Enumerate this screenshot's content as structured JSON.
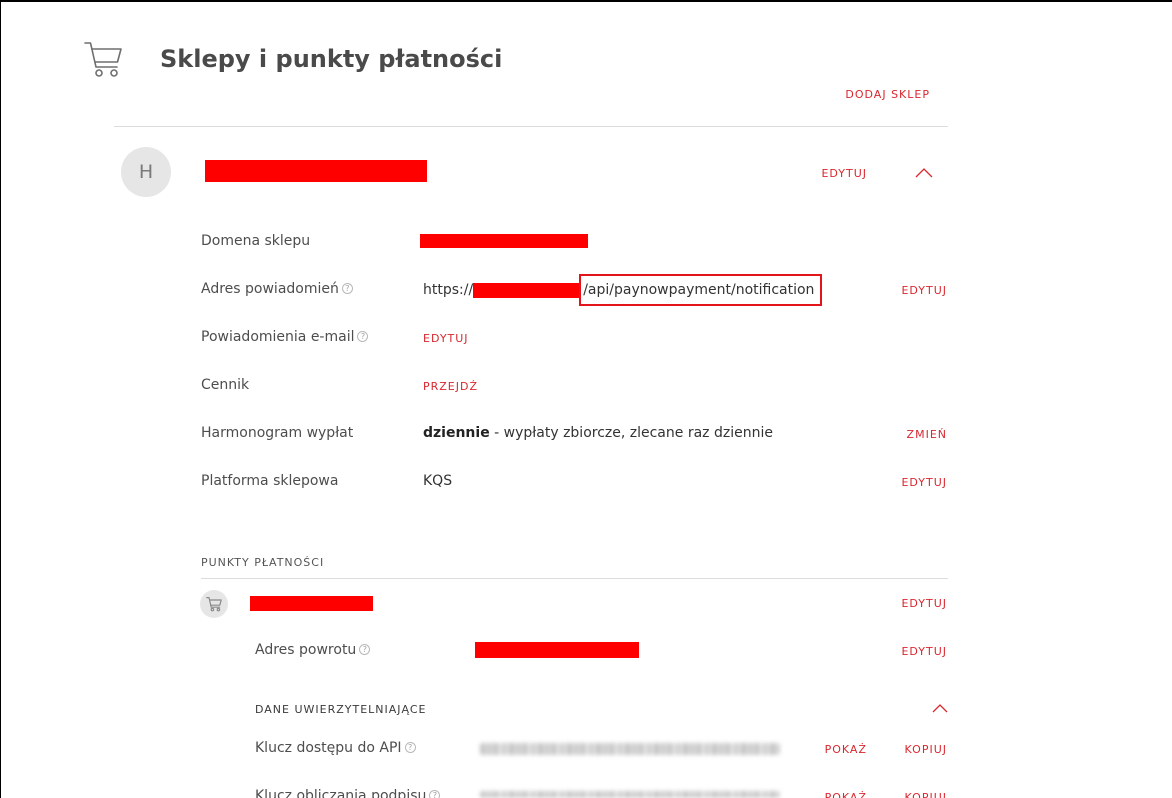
{
  "page": {
    "title": "Sklepy i punkty płatności",
    "add_shop_label": "DODAJ SKLEP"
  },
  "icons": {
    "header": "shopping-cart-icon",
    "help": "help-icon",
    "collapse": "chevron-up-icon",
    "payment_point": "shopping-cart-icon"
  },
  "colors": {
    "accent": "#d9272e",
    "highlight_box": "#e3141b",
    "redaction": "#ff0000",
    "avatar_bg": "#e6e6e6",
    "title": "#4a4a4a"
  },
  "shop": {
    "avatar_letter": "H",
    "edit_label": "EDYTUJ",
    "details": {
      "domain": {
        "label": "Domena sklepu"
      },
      "notification_url": {
        "label": "Adres powiadomień",
        "prefix": "https://",
        "path": "/api/paynowpayment/notification",
        "action": "EDYTUJ"
      },
      "email_notifications": {
        "label": "Powiadomienia e-mail",
        "action": "EDYTUJ"
      },
      "pricing": {
        "label": "Cennik",
        "action": "PRZEJDŹ"
      },
      "payout_schedule": {
        "label": "Harmonogram wypłat",
        "value_bold": "dziennie",
        "value_rest": "- wypłaty zbiorcze, zlecane raz dziennie",
        "action": "ZMIEŃ"
      },
      "platform": {
        "label": "Platforma sklepowa",
        "value": "KQS",
        "action": "EDYTUJ"
      }
    }
  },
  "payment_points": {
    "heading": "PUNKTY PŁATNOŚCI",
    "items": [
      {
        "edit_label": "EDYTUJ",
        "return_url": {
          "label": "Adres powrotu",
          "action": "EDYTUJ"
        },
        "credentials": {
          "heading": "DANE UWIERZYTELNIAJĄCE",
          "keys": [
            {
              "label": "Klucz dostępu do API",
              "show_label": "POKAŻ",
              "copy_label": "KOPIUJ"
            },
            {
              "label": "Klucz obliczania podpisu",
              "show_label": "POKAŻ",
              "copy_label": "KOPIUJ"
            }
          ]
        }
      }
    ]
  }
}
